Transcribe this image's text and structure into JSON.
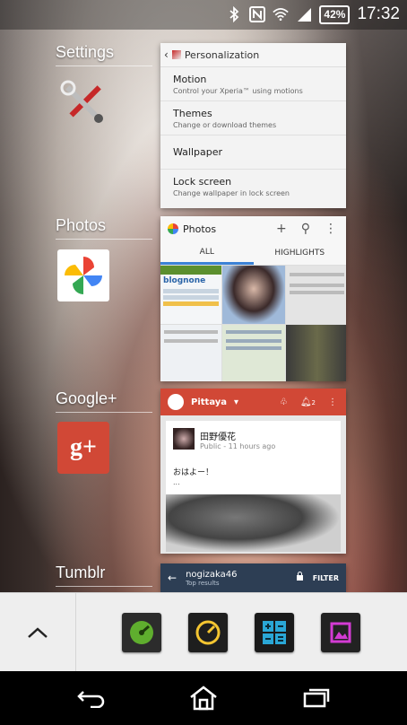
{
  "status_bar": {
    "battery": "42%",
    "time": "17:32",
    "icons": [
      "bluetooth-icon",
      "nfc-icon",
      "wifi-icon",
      "signal-icon",
      "battery-icon"
    ]
  },
  "recent_apps": [
    {
      "label": "Settings",
      "icon": "settings-tools-icon"
    },
    {
      "label": "Photos",
      "icon": "photos-pinwheel-icon"
    },
    {
      "label": "Google+",
      "icon": "google-plus-icon"
    },
    {
      "label": "Tumblr",
      "icon": "tumblr-icon"
    }
  ],
  "settings_card": {
    "title": "Personalization",
    "items": [
      {
        "title": "Motion",
        "subtitle": "Control your Xperia™ using motions"
      },
      {
        "title": "Themes",
        "subtitle": "Change or download themes"
      },
      {
        "title": "Wallpaper",
        "subtitle": ""
      },
      {
        "title": "Lock screen",
        "subtitle": "Change wallpaper in lock screen"
      }
    ]
  },
  "photos_card": {
    "title": "Photos",
    "tabs": [
      "ALL",
      "HIGHLIGHTS"
    ],
    "thumb_text": "blognone"
  },
  "gplus_card": {
    "account": "Pittaya",
    "notification_count": "2",
    "post_author": "田野優花",
    "post_meta": "Public - 11 hours ago",
    "post_text": "おはよー！",
    "post_more": "..."
  },
  "tumblr_card": {
    "title": "nogizaka46",
    "subtitle": "Top results",
    "filter": "FILTER"
  },
  "dock": {
    "apps": [
      "speedometer-app-icon",
      "compass-app-icon",
      "calculator-app-icon",
      "photo-editor-app-icon"
    ]
  },
  "colors": {
    "gplus_red": "#d14836",
    "tumblr_navy": "#2d3e54",
    "photos_tab_blue": "#3b82d6"
  }
}
